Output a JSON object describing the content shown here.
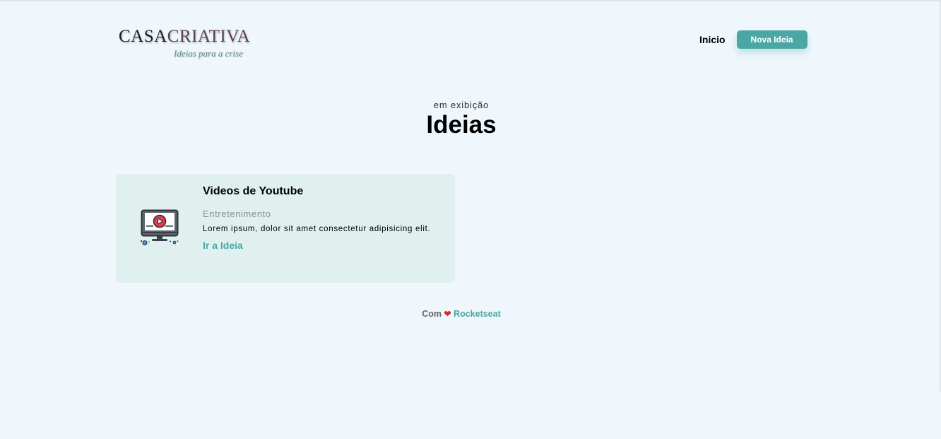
{
  "header": {
    "logo": {
      "text_part_a": "CASA",
      "text_part_b": "CRIATIVA",
      "tagline": "Ideias para a crise"
    },
    "nav": {
      "home_label": "Inicio",
      "new_idea_label": "Nova Ideia"
    }
  },
  "section": {
    "subtitle": "em exibição",
    "title": "Ideias"
  },
  "ideas": [
    {
      "title": "Videos de Youtube",
      "category": "Entretenimento",
      "description": "Lorem ipsum, dolor sit amet consectetur adipisicing elit.",
      "link_label": "Ir a Ideia",
      "image_icon": "youtube-monitor-icon"
    }
  ],
  "footer": {
    "prefix": "Com",
    "heart": "❤",
    "brand": "Rocketseat"
  },
  "colors": {
    "background": "#eff7fd",
    "accent": "#4ba7a4",
    "card_background": "#dff0ef",
    "heart": "#e02424"
  }
}
